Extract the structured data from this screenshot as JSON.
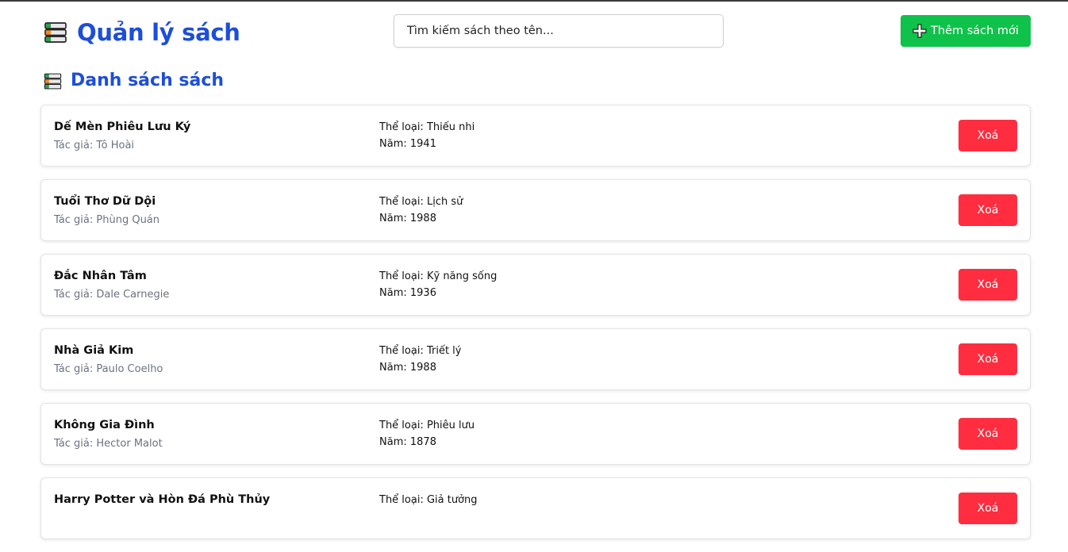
{
  "header": {
    "title": "Quản lý sách",
    "search_placeholder": "Tìm kiếm sách theo tên...",
    "add_button_label": "Thêm sách mới"
  },
  "section": {
    "title": "Danh sách sách"
  },
  "labels": {
    "author_prefix": "Tác giả: ",
    "genre_prefix": "Thể loại: ",
    "year_prefix": "Năm: ",
    "delete_label": "Xoá"
  },
  "colors": {
    "brand": "#1d4ed8",
    "add": "#0ec24a",
    "delete": "#ff2d3f"
  },
  "icons": {
    "app": "books-stack-icon",
    "add": "plus-icon"
  },
  "books": [
    {
      "title": "Dế Mèn Phiêu Lưu Ký",
      "author": "Tô Hoài",
      "genre": "Thiếu nhi",
      "year": "1941"
    },
    {
      "title": "Tuổi Thơ Dữ Dội",
      "author": "Phùng Quán",
      "genre": "Lịch sử",
      "year": "1988"
    },
    {
      "title": "Đắc Nhân Tâm",
      "author": "Dale Carnegie",
      "genre": "Kỹ năng sống",
      "year": "1936"
    },
    {
      "title": "Nhà Giả Kim",
      "author": "Paulo Coelho",
      "genre": "Triết lý",
      "year": "1988"
    },
    {
      "title": "Không Gia Đình",
      "author": "Hector Malot",
      "genre": "Phiêu lưu",
      "year": "1878"
    },
    {
      "title": "Harry Potter và Hòn Đá Phù Thủy",
      "author": "",
      "genre": "Giả tưởng",
      "year": ""
    }
  ]
}
